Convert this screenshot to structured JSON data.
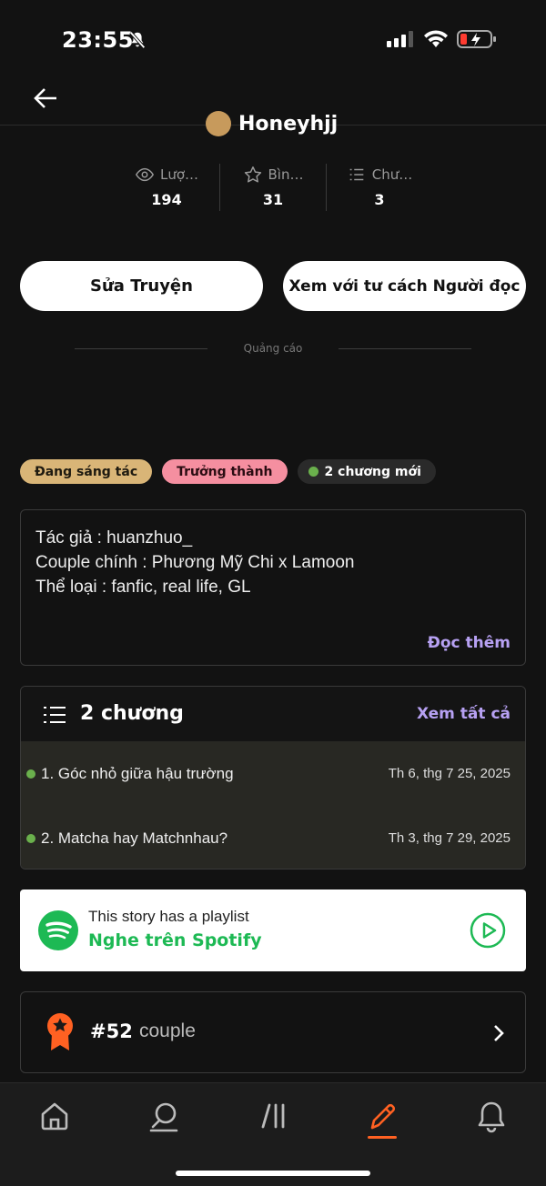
{
  "status_bar": {
    "time": "23:55"
  },
  "header": {
    "back_label": "Back"
  },
  "author": {
    "name": "Honeyhjj"
  },
  "stats": [
    {
      "icon": "eye-icon",
      "label": "Lượ…",
      "value": "194"
    },
    {
      "icon": "star-icon",
      "label": "Bìn…",
      "value": "31"
    },
    {
      "icon": "list-icon",
      "label": "Chư…",
      "value": "3"
    }
  ],
  "actions": {
    "edit_label": "Sửa Truyện",
    "view_label": "Xem với tư cách Người đọc"
  },
  "ad": {
    "label": "Quảng cáo"
  },
  "tags": {
    "status": "Đang sáng tác",
    "mature": "Trưởng thành",
    "new_chapters": "2 chương mới"
  },
  "description": {
    "lines": [
      "Tác giả : huanzhuo_",
      "Couple chính : Phương Mỹ Chi x Lamoon",
      "Thể loại : fanfic, real life, GL"
    ],
    "read_more": "Đọc thêm"
  },
  "chapters": {
    "title": "2 chương",
    "see_all": "Xem tất cả",
    "items": [
      {
        "name": "1. Góc nhỏ giữa hậu trường",
        "date": "Th 6, thg 7 25, 2025"
      },
      {
        "name": "2. Matcha hay Matchnhau?",
        "date": "Th 3, thg 7 29, 2025"
      }
    ]
  },
  "spotify": {
    "line1": "This story has a playlist",
    "line2": "Nghe trên Spotify"
  },
  "ranking": {
    "rank": "#52",
    "tag": "couple"
  },
  "colors": {
    "accent": "#b7a1f3",
    "spotify": "#1db954",
    "orange": "#ff6122",
    "tag_writing": "#d9b577",
    "tag_mature": "#f58fa0"
  },
  "tabbar": {
    "active": "write"
  }
}
